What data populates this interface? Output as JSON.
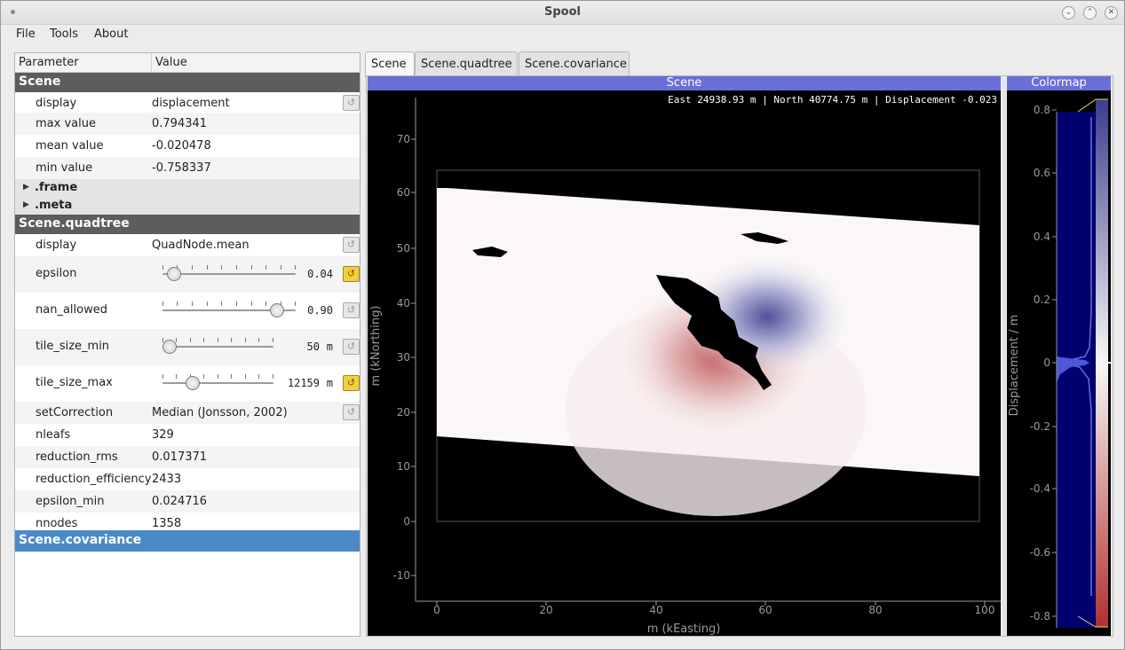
{
  "window": {
    "title": "Spool"
  },
  "menu": [
    "File",
    "Tools",
    "About"
  ],
  "tree": {
    "headers": {
      "parameter": "Parameter",
      "value": "Value"
    },
    "scene": {
      "label": "Scene",
      "rows": [
        {
          "name": "display",
          "value": "displacement"
        },
        {
          "name": "max value",
          "value": "0.794341"
        },
        {
          "name": "mean value",
          "value": "-0.020478"
        },
        {
          "name": "min value",
          "value": "-0.758337"
        }
      ],
      "sub": [
        ".frame",
        ".meta"
      ]
    },
    "quadtree": {
      "label": "Scene.quadtree",
      "display": {
        "name": "display",
        "value": "QuadNode.mean"
      },
      "epsilon": {
        "name": "epsilon",
        "value": "0.04",
        "fraction": 0.08
      },
      "nan_allowed": {
        "name": "nan_allowed",
        "value": "0.90",
        "fraction": 0.9
      },
      "tile_size_min": {
        "name": "tile_size_min",
        "value": "50",
        "unit": "m",
        "fraction": 0.0
      },
      "tile_size_max": {
        "name": "tile_size_max",
        "value": "12159",
        "unit": "m",
        "fraction": 0.22
      },
      "setCorrection": {
        "name": "setCorrection",
        "value": "Median (Jonsson, 2002)"
      },
      "rows": [
        {
          "name": "nleafs",
          "value": "329"
        },
        {
          "name": "reduction_rms",
          "value": "0.017371"
        },
        {
          "name": "reduction_efficiency",
          "value": "2433"
        },
        {
          "name": "epsilon_min",
          "value": "0.024716"
        },
        {
          "name": "nnodes",
          "value": "1358"
        }
      ]
    },
    "covariance": {
      "label": "Scene.covariance"
    }
  },
  "tabs": [
    "Scene",
    "Scene.quadtree",
    "Scene.covariance"
  ],
  "scene_plot": {
    "dock_title": "Scene",
    "coords": "East 24938.93 m | North 40774.75 m | Displacement -0.023",
    "xlabel": "m (kEasting)",
    "ylabel": "m (kNorthing)",
    "xticks": [
      "0",
      "20",
      "40",
      "60",
      "80",
      "100"
    ],
    "yticks": [
      "70",
      "60",
      "50",
      "40",
      "30",
      "20",
      "10",
      "0",
      "-10"
    ]
  },
  "colormap": {
    "dock_title": "Colormap",
    "label": "Displacement / m",
    "ticks": [
      "0.8",
      "0.6",
      "0.4",
      "0.2",
      "0",
      "-0.2",
      "-0.4",
      "-0.6",
      "-0.8"
    ]
  },
  "colors": {
    "accent": "#6a6fd8",
    "group": "#5d5d5d",
    "selected": "#4a8ac8",
    "positive": "#c04a4a",
    "negative": "#3e3f8f"
  }
}
